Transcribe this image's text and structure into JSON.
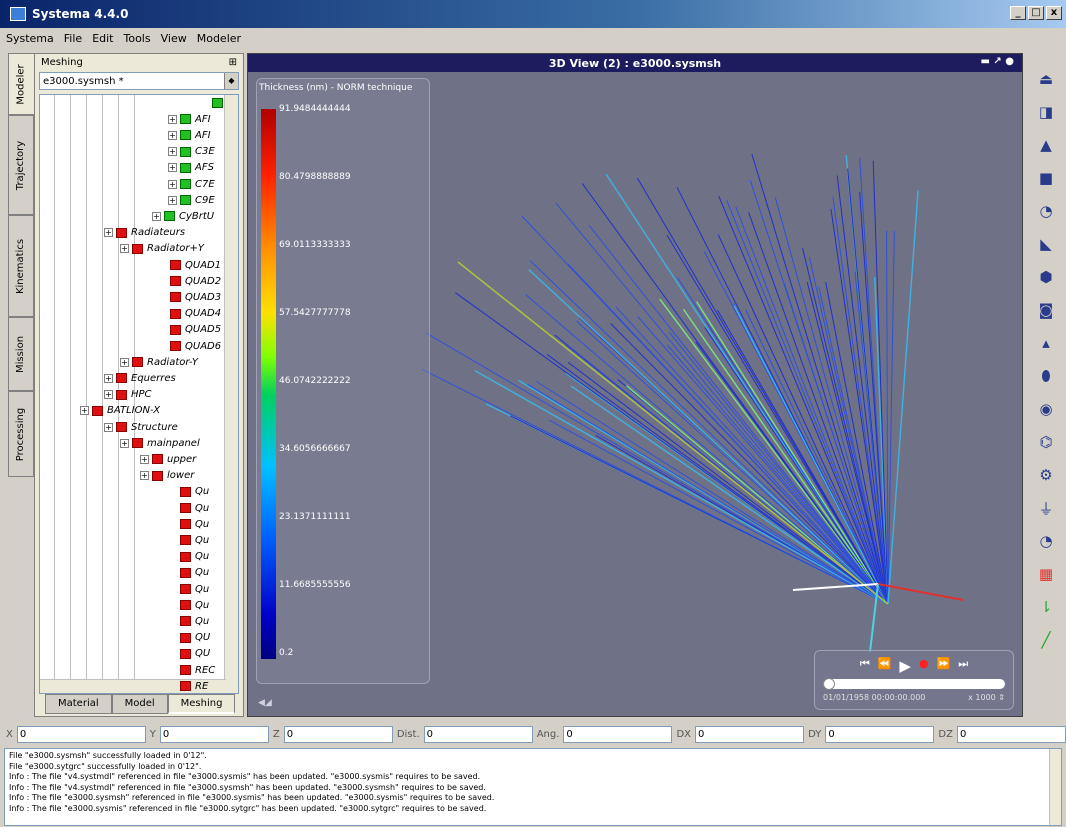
{
  "window": {
    "title": "Systema 4.4.0",
    "min": "_",
    "max": "□",
    "close": "x"
  },
  "menu": [
    "Systema",
    "File",
    "Edit",
    "Tools",
    "View",
    "Modeler"
  ],
  "sidetabs": [
    "Modeler",
    "Trajectory",
    "Kinematics",
    "Mission",
    "Processing"
  ],
  "panel": {
    "title": "Meshing",
    "pin": "⊞",
    "file": "e3000.sysmsh *",
    "tree": [
      {
        "label": "",
        "kind": "g"
      },
      {
        "label": "AFI",
        "kind": "g"
      },
      {
        "label": "AFI",
        "kind": "g"
      },
      {
        "label": "C3E",
        "kind": "g"
      },
      {
        "label": "AFS",
        "kind": "g"
      },
      {
        "label": "C7E",
        "kind": "g"
      },
      {
        "label": "C9E",
        "kind": "g"
      },
      {
        "label": "CyBrtU",
        "kind": "g"
      },
      {
        "label": "Radiateurs",
        "kind": "r"
      },
      {
        "label": "Radiator+Y",
        "kind": "r"
      },
      {
        "label": "QUAD1",
        "kind": "r"
      },
      {
        "label": "QUAD2",
        "kind": "r"
      },
      {
        "label": "QUAD3",
        "kind": "r"
      },
      {
        "label": "QUAD4",
        "kind": "r"
      },
      {
        "label": "QUAD5",
        "kind": "r"
      },
      {
        "label": "QUAD6",
        "kind": "r"
      },
      {
        "label": "Radiator-Y",
        "kind": "r"
      },
      {
        "label": "Equerres",
        "kind": "r"
      },
      {
        "label": "HPC",
        "kind": "r"
      },
      {
        "label": "BATLION-X",
        "kind": "r"
      },
      {
        "label": "Structure",
        "kind": "r"
      },
      {
        "label": "mainpanel",
        "kind": "r"
      },
      {
        "label": "upper",
        "kind": "r"
      },
      {
        "label": "lower",
        "kind": "r"
      },
      {
        "label": "Qu",
        "kind": "r"
      },
      {
        "label": "Qu",
        "kind": "r"
      },
      {
        "label": "Qu",
        "kind": "r"
      },
      {
        "label": "Qu",
        "kind": "r"
      },
      {
        "label": "Qu",
        "kind": "r"
      },
      {
        "label": "Qu",
        "kind": "r"
      },
      {
        "label": "Qu",
        "kind": "r"
      },
      {
        "label": "Qu",
        "kind": "r"
      },
      {
        "label": "Qu",
        "kind": "r"
      },
      {
        "label": "QU",
        "kind": "r"
      },
      {
        "label": "QU",
        "kind": "r"
      },
      {
        "label": "REC",
        "kind": "r"
      },
      {
        "label": "RE",
        "kind": "r"
      }
    ],
    "tabs": [
      "Material",
      "Model",
      "Meshing"
    ]
  },
  "view": {
    "title": "3D View (2) : e3000.sysmsh",
    "controls": "▬  ↗  ●",
    "legend_title": "Thickness (nm) - NORM technique",
    "legend_ticks": [
      "91.9484444444",
      "80.4798888889",
      "69.0113333333",
      "57.5427777778",
      "46.0742222222",
      "34.6056666667",
      "23.1371111111",
      "11.6685555556",
      "0.2"
    ],
    "corner_icon": "◀◢",
    "player": {
      "date": "01/01/1958 00:00:00.000",
      "speed": "x 1000 ⇕",
      "buttons": [
        "⏮",
        "⏪",
        "▶",
        "●",
        "⏩",
        "⏭"
      ]
    }
  },
  "coords": [
    {
      "label": "X",
      "value": "0"
    },
    {
      "label": "Y",
      "value": "0"
    },
    {
      "label": "Z",
      "value": "0"
    },
    {
      "label": "Dist.",
      "value": "0"
    },
    {
      "label": "Ang.",
      "value": "0"
    },
    {
      "label": "DX",
      "value": "0"
    },
    {
      "label": "DY",
      "value": "0"
    },
    {
      "label": "DZ",
      "value": "0"
    }
  ],
  "log": [
    "File \"e3000.sysmsh\" successfully loaded in 0'12\".",
    "File \"e3000.sytgrc\" successfully loaded in 0'12\".",
    "Info   : The file \"v4.systmdl\" referenced in file \"e3000.sysmis\" has been updated. \"e3000.sysmis\" requires to be saved.",
    "Info   : The file \"v4.systmdl\" referenced in file \"e3000.sysmsh\" has been updated. \"e3000.sysmsh\" requires to be saved.",
    "Info   : The file \"e3000.sysmsh\" referenced in file \"e3000.sysmis\" has been updated. \"e3000.sysmis\" requires to be saved.",
    "Info   : The file \"e3000.sysmis\" referenced in file \"e3000.sytgrc\" has been updated. \"e3000.sytgrc\" requires to be saved."
  ],
  "tools": [
    "⏏",
    "◨",
    "▲",
    "■",
    "◔",
    "◣",
    "⬢",
    "◙",
    "▴",
    "⬮",
    "◉",
    "⌬",
    "⚙",
    "⏚",
    "◔",
    "▦",
    "⇂",
    "╱"
  ]
}
